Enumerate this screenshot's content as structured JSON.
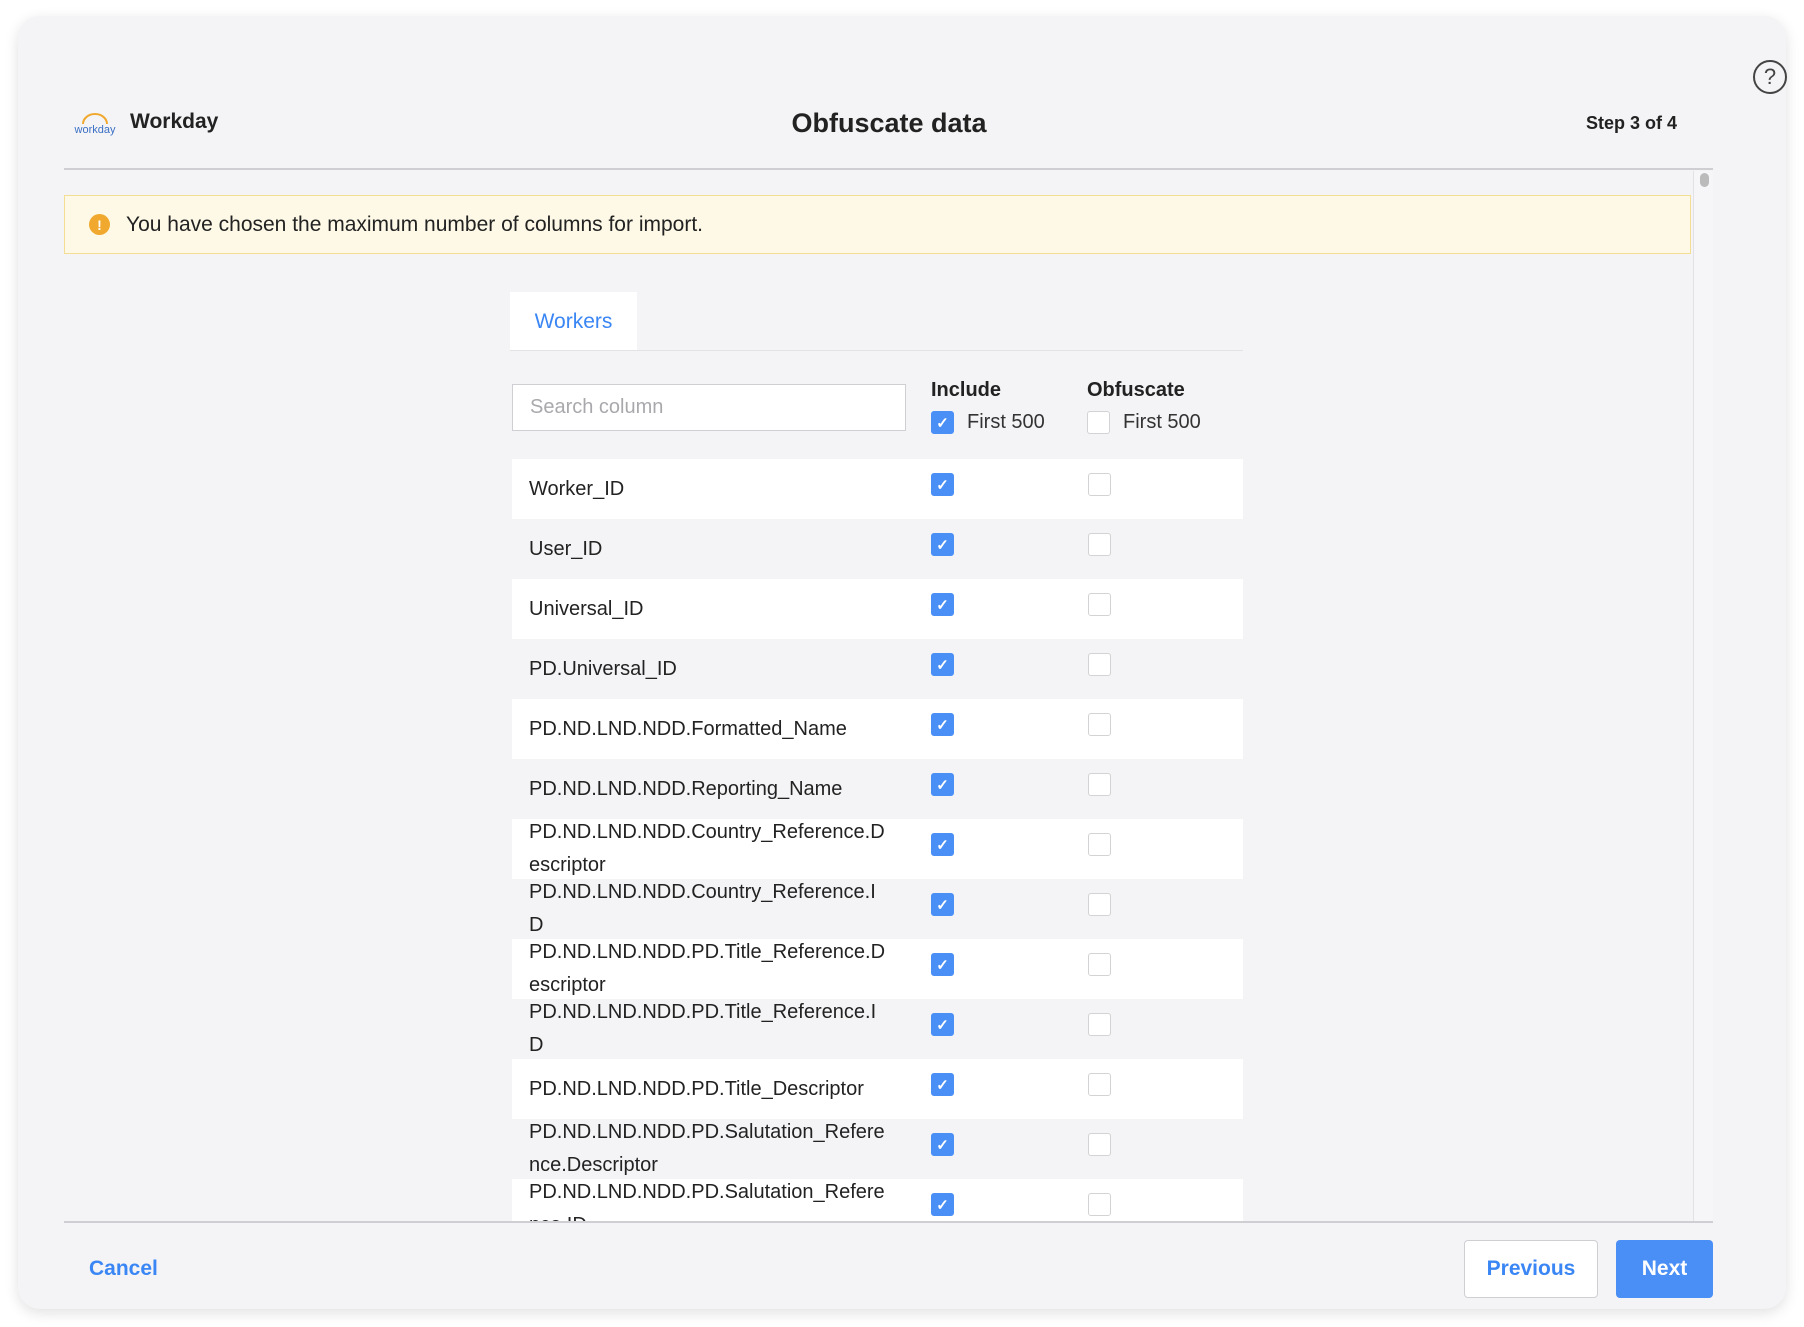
{
  "header": {
    "logo_text": "workday",
    "brand": "Workday",
    "title": "Obfuscate data",
    "step": "Step 3 of 4",
    "help_icon": "question-circle-icon"
  },
  "banner": {
    "icon": "warning-icon",
    "icon_glyph": "!",
    "message": "You have chosen the maximum number of columns for import."
  },
  "tabs": [
    {
      "label": "Workers",
      "active": true
    }
  ],
  "search": {
    "placeholder": "Search column",
    "value": ""
  },
  "columns": {
    "include": {
      "label": "Include",
      "first500_label": "First 500",
      "first500_checked": true
    },
    "obfuscate": {
      "label": "Obfuscate",
      "first500_label": "First 500",
      "first500_checked": false
    }
  },
  "rows": [
    {
      "name": "Worker_ID",
      "include": true,
      "obfuscate": false
    },
    {
      "name": "User_ID",
      "include": true,
      "obfuscate": false
    },
    {
      "name": "Universal_ID",
      "include": true,
      "obfuscate": false
    },
    {
      "name": "PD.Universal_ID",
      "include": true,
      "obfuscate": false
    },
    {
      "name": "PD.ND.LND.NDD.Formatted_Name",
      "include": true,
      "obfuscate": false
    },
    {
      "name": "PD.ND.LND.NDD.Reporting_Name",
      "include": true,
      "obfuscate": false
    },
    {
      "name": "PD.ND.LND.NDD.Country_Reference.Descriptor",
      "include": true,
      "obfuscate": false
    },
    {
      "name": "PD.ND.LND.NDD.Country_Reference.ID",
      "include": true,
      "obfuscate": false
    },
    {
      "name": "PD.ND.LND.NDD.PD.Title_Reference.Descriptor",
      "include": true,
      "obfuscate": false
    },
    {
      "name": "PD.ND.LND.NDD.PD.Title_Reference.ID",
      "include": true,
      "obfuscate": false
    },
    {
      "name": "PD.ND.LND.NDD.PD.Title_Descriptor",
      "include": true,
      "obfuscate": false
    },
    {
      "name": "PD.ND.LND.NDD.PD.Salutation_Reference.Descriptor",
      "include": true,
      "obfuscate": false
    },
    {
      "name": "PD.ND.LND.NDD.PD.Salutation_Reference.ID",
      "include": true,
      "obfuscate": false
    }
  ],
  "footer": {
    "cancel": "Cancel",
    "previous": "Previous",
    "next": "Next"
  },
  "colors": {
    "accent": "#4a8ff5",
    "link": "#3a86f4",
    "warning": "#f0a92e",
    "banner_bg": "#fdf9e6"
  }
}
